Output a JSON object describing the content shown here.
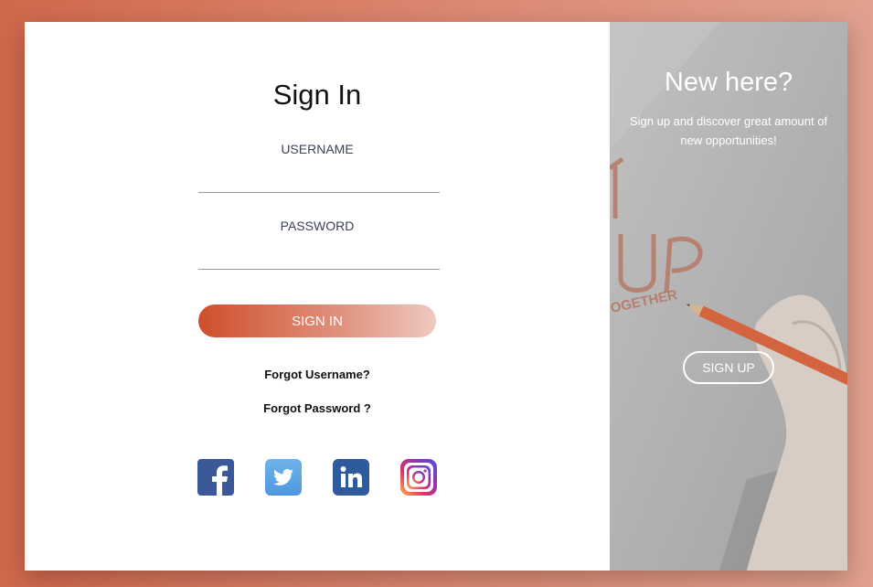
{
  "signin": {
    "title": "Sign In",
    "username_label": "USERNAME",
    "username_value": "",
    "password_label": "PASSWORD",
    "password_value": "",
    "button_label": "SIGN IN",
    "forgot_username": "Forgot Username?",
    "forgot_password": "Forgot Password ?"
  },
  "social": {
    "icons": [
      "facebook-icon",
      "twitter-icon",
      "linkedin-icon",
      "instagram-icon"
    ],
    "colors": {
      "facebook": "#3b5998",
      "twitter": "#55acee",
      "linkedin": "#2f5b9d",
      "instagram": "#833ab4"
    }
  },
  "signup_panel": {
    "title": "New here?",
    "subtitle": "Sign up and discover great amount of new opportunities!",
    "button_label": "SIGN UP"
  },
  "colors": {
    "accent": "#cf4f2c",
    "background": "#d0684c"
  }
}
